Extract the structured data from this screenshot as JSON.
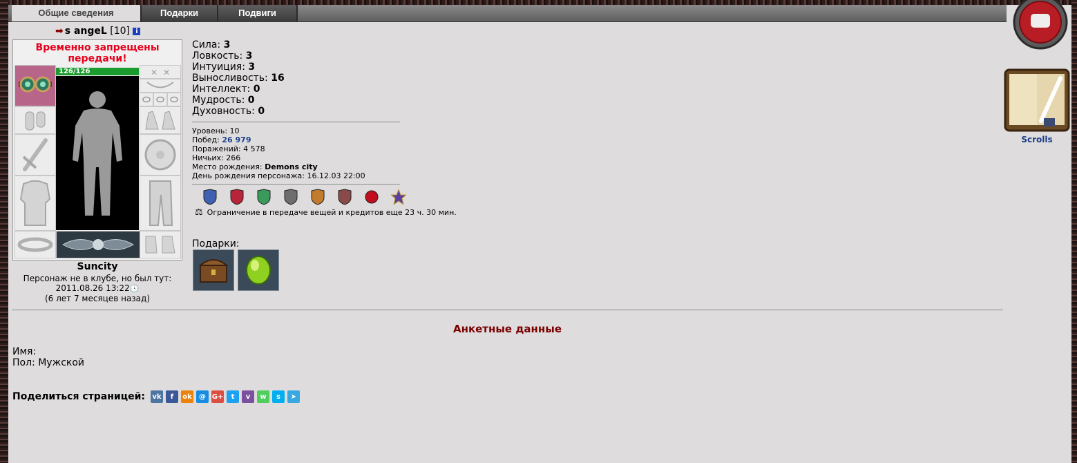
{
  "tabs": [
    {
      "label": "Общие сведения",
      "active": true
    },
    {
      "label": "Подарки",
      "active": false
    },
    {
      "label": "Подвиги",
      "active": false
    }
  ],
  "character": {
    "name": "s angeL",
    "level": "[10]",
    "transfer_ban": "Временно запрещены передачи!",
    "hp": "126/126",
    "city": "Suncity",
    "last_seen_label": "Персонаж не в клубе, но был тут:",
    "last_seen_time": "2011.08.26 13:22",
    "last_seen_ago": "(6 лет 7 месяцев назад)"
  },
  "stats": [
    {
      "label": "Сила:",
      "value": "3"
    },
    {
      "label": "Ловкость:",
      "value": "3"
    },
    {
      "label": "Интуиция:",
      "value": "3"
    },
    {
      "label": "Выносливость:",
      "value": "16"
    },
    {
      "label": "Интеллект:",
      "value": "0"
    },
    {
      "label": "Мудрость:",
      "value": "0"
    },
    {
      "label": "Духовность:",
      "value": "0"
    }
  ],
  "info": {
    "level_label": "Уровень:",
    "level": "10",
    "wins_label": "Побед:",
    "wins": "26 979",
    "losses_label": "Поражений:",
    "losses": "4 578",
    "draws_label": "Ничьих:",
    "draws": "266",
    "birthplace_label": "Место рождения:",
    "birthplace": "Demons city",
    "birthday_label": "День рождения персонажа:",
    "birthday": "16.12.03 22:00"
  },
  "restriction": "Ограничение в передаче вещей и кредитов еще 23 ч. 30 мин.",
  "gifts_label": "Подарки:",
  "scrolls_label": "Scrolls",
  "profile": {
    "title": "Анкетные данные",
    "name_label": "Имя:",
    "sex_label": "Пол:",
    "sex": "Мужской"
  },
  "share": {
    "label": "Поделиться страницей:",
    "icons": [
      {
        "name": "vk-icon",
        "text": "vk",
        "color": "#4c75a3"
      },
      {
        "name": "facebook-icon",
        "text": "f",
        "color": "#3b5998"
      },
      {
        "name": "odnoklassniki-icon",
        "text": "ok",
        "color": "#ee8208"
      },
      {
        "name": "moimir-icon",
        "text": "@",
        "color": "#168de2"
      },
      {
        "name": "googleplus-icon",
        "text": "G+",
        "color": "#dc4e41"
      },
      {
        "name": "twitter-icon",
        "text": "t",
        "color": "#1da1f2"
      },
      {
        "name": "viber-icon",
        "text": "v",
        "color": "#7b519d"
      },
      {
        "name": "whatsapp-icon",
        "text": "w",
        "color": "#4fce5d"
      },
      {
        "name": "skype-icon",
        "text": "s",
        "color": "#00aff0"
      },
      {
        "name": "telegram-icon",
        "text": "➤",
        "color": "#3aa8e0"
      }
    ]
  },
  "colors": {
    "background": "#dedcdd",
    "ban_red": "#e8001c",
    "wins_blue": "#1b3f8c",
    "title_maroon": "#7a0000",
    "hp_green": "#1a9c2e"
  }
}
